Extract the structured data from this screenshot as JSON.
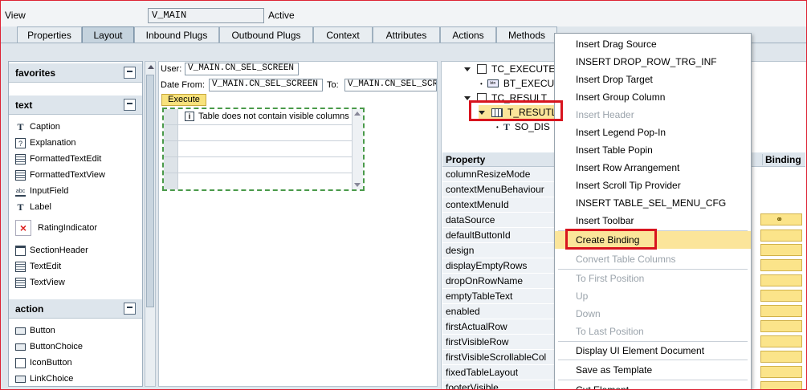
{
  "header": {
    "view_label": "View",
    "view_value": "V_MAIN",
    "status": "Active"
  },
  "tabs": [
    "Properties",
    "Layout",
    "Inbound Plugs",
    "Outbound Plugs",
    "Context",
    "Attributes",
    "Actions",
    "Methods"
  ],
  "active_tab": "Layout",
  "left_panel": {
    "sections": [
      {
        "title": "favorites",
        "items": []
      },
      {
        "title": "text",
        "items": [
          {
            "label": "Caption",
            "icon": "caption-icon"
          },
          {
            "label": "Explanation",
            "icon": "explanation-icon"
          },
          {
            "label": "FormattedTextEdit",
            "icon": "formatted-text-edit-icon"
          },
          {
            "label": "FormattedTextView",
            "icon": "formatted-text-view-icon"
          },
          {
            "label": "InputField",
            "icon": "input-field-icon"
          },
          {
            "label": "Label",
            "icon": "label-icon"
          },
          {
            "label": "RatingIndicator",
            "icon": "rating-indicator-icon"
          },
          {
            "label": "SectionHeader",
            "icon": "section-header-icon"
          },
          {
            "label": "TextEdit",
            "icon": "text-edit-icon"
          },
          {
            "label": "TextView",
            "icon": "text-view-icon"
          }
        ]
      },
      {
        "title": "action",
        "items": [
          {
            "label": "Button",
            "icon": "button-icon"
          },
          {
            "label": "ButtonChoice",
            "icon": "button-choice-icon"
          },
          {
            "label": "IconButton",
            "icon": "icon-button-icon"
          },
          {
            "label": "LinkChoice",
            "icon": "link-choice-icon"
          }
        ]
      }
    ]
  },
  "designer": {
    "user_label": "User:",
    "user_value": "V_MAIN.CN_SEL_SCREEN",
    "date_from_label": "Date From:",
    "date_from_value": "V_MAIN.CN_SEL_SCREEN",
    "to_label": "To:",
    "to_value": "V_MAIN.CN_SEL_SCR",
    "execute_button": "Execute",
    "table_message": "Table does not contain visible columns"
  },
  "tree": {
    "items": [
      {
        "label": "TC_EXECUTE",
        "level": 0
      },
      {
        "label": "BT_EXECU",
        "level": 1
      },
      {
        "label": "TC_RESULT",
        "level": 0
      },
      {
        "label": "T_RESUTL",
        "level": 1
      },
      {
        "label": "SO_DIS",
        "level": 2
      }
    ]
  },
  "properties": {
    "col_property": "Property",
    "col_binding": "Binding",
    "rows": [
      "columnResizeMode",
      "contextMenuBehaviour",
      "contextMenuId",
      "dataSource",
      "defaultButtonId",
      "design",
      "displayEmptyRows",
      "dropOnRowName",
      "emptyTableText",
      "enabled",
      "firstActualRow",
      "firstVisibleRow",
      "firstVisibleScrollableCol",
      "fixedTableLayout",
      "footerVisible"
    ]
  },
  "context_menu": {
    "items": [
      {
        "label": "Insert Drag Source",
        "disabled": false
      },
      {
        "label": "INSERT DROP_ROW_TRG_INF",
        "disabled": false
      },
      {
        "label": "Insert Drop Target",
        "disabled": false
      },
      {
        "label": "Insert Group Column",
        "disabled": false
      },
      {
        "label": "Insert Header",
        "disabled": true
      },
      {
        "label": "Insert Legend Pop-In",
        "disabled": false
      },
      {
        "label": "Insert Table Popin",
        "disabled": false
      },
      {
        "label": "Insert Row Arrangement",
        "disabled": false
      },
      {
        "label": "Insert Scroll Tip Provider",
        "disabled": false
      },
      {
        "label": "INSERT TABLE_SEL_MENU_CFG",
        "disabled": false
      },
      {
        "label": "Insert Toolbar",
        "disabled": false
      },
      {
        "label": "Create Binding",
        "disabled": false,
        "highlighted": true
      },
      {
        "label": "Convert Table Columns",
        "disabled": true
      },
      {
        "label": "To First Position",
        "disabled": true
      },
      {
        "label": "Up",
        "disabled": true
      },
      {
        "label": "Down",
        "disabled": true
      },
      {
        "label": "To Last Position",
        "disabled": true
      },
      {
        "label": "Display UI Element Document",
        "disabled": false
      },
      {
        "label": "Save as Template",
        "disabled": false
      },
      {
        "label": "Cut Element",
        "disabled": false
      }
    ]
  },
  "colors": {
    "accent": "#fbe59a",
    "highlight_box": "#d8141e",
    "grid_border": "#4a9a4a"
  }
}
